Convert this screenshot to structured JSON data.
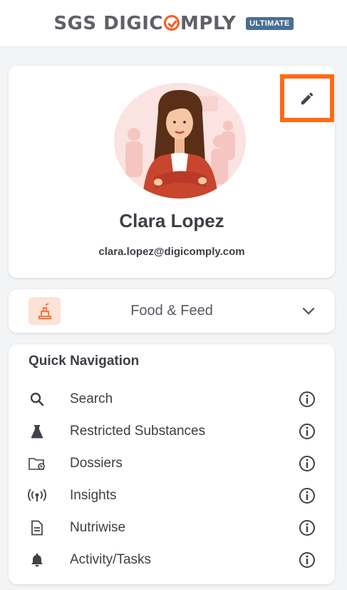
{
  "header": {
    "logo_prefix": "SGS DIGIC",
    "logo_suffix": "MPLY",
    "badge": "ULTIMATE",
    "colors": {
      "logo_text": "#5f6166",
      "logo_accent": "#ff5a1f",
      "badge_bg": "#4a6e93"
    }
  },
  "profile": {
    "name": "Clara Lopez",
    "email": "clara.lopez@digicomply.com",
    "edit_icon": "pencil-icon",
    "highlight_color": "#ff6a13"
  },
  "sector_selector": {
    "label": "Food & Feed",
    "icon": "food-feed-icon",
    "chevron": "chevron-down-icon"
  },
  "quick_navigation": {
    "title": "Quick Navigation",
    "items": [
      {
        "label": "Search",
        "icon": "search-icon"
      },
      {
        "label": "Restricted Substances",
        "icon": "flask-icon"
      },
      {
        "label": "Dossiers",
        "icon": "folder-attachment-icon"
      },
      {
        "label": "Insights",
        "icon": "broadcast-icon"
      },
      {
        "label": "Nutriwise",
        "icon": "document-icon"
      },
      {
        "label": "Activity/Tasks",
        "icon": "bell-icon"
      }
    ],
    "info_icon": "info-icon"
  }
}
